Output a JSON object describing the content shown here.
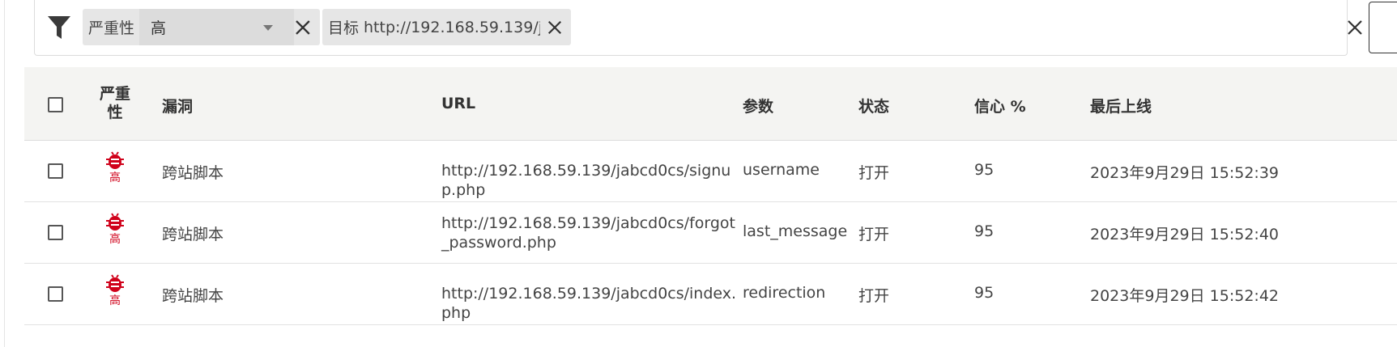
{
  "filter_bar": {
    "chips": [
      {
        "label": "严重性",
        "value": "高"
      },
      {
        "label": "目标",
        "value": "http://192.168.59.139/ja..."
      }
    ]
  },
  "table": {
    "headers": {
      "severity": "严重\n性",
      "vuln": "漏洞",
      "url": "URL",
      "param": "参数",
      "status": "状态",
      "confidence": "信心 %",
      "last_seen": "最后上线"
    },
    "rows": [
      {
        "severity": "高",
        "vuln": "跨站脚本",
        "url": "http://192.168.59.139/jabcd0cs/signup.php",
        "param": "username",
        "status": "打开",
        "confidence": "95",
        "last_seen": "2023年9月29日 15:52:39"
      },
      {
        "severity": "高",
        "vuln": "跨站脚本",
        "url": "http://192.168.59.139/jabcd0cs/forgot_password.php",
        "param": "last_message",
        "status": "打开",
        "confidence": "95",
        "last_seen": "2023年9月29日 15:52:40"
      },
      {
        "severity": "高",
        "vuln": "跨站脚本",
        "url": "http://192.168.59.139/jabcd0cs/index.php",
        "param": "redirection",
        "status": "打开",
        "confidence": "95",
        "last_seen": "2023年9月29日 15:52:42"
      }
    ]
  },
  "icons": {
    "filter": "filter-icon",
    "remove_filter": "close-icon",
    "severity": "bug-icon"
  },
  "colors": {
    "severity_high": "#d0021b",
    "header_bg": "#f4f4f2",
    "chip_bg": "#e6e6e6"
  }
}
